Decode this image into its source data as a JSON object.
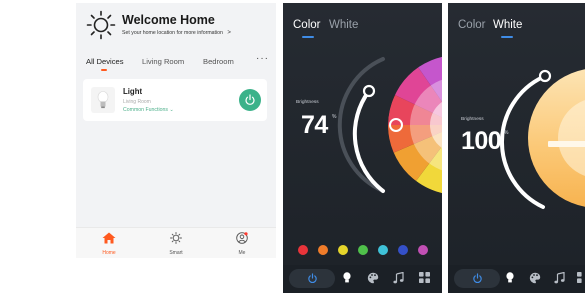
{
  "home": {
    "title": "Welcome Home",
    "subtitle": "Set your home location for more information",
    "subtitle_chevron": ">",
    "tabs": [
      {
        "label": "All Devices",
        "active": true
      },
      {
        "label": "Living Room",
        "active": false
      },
      {
        "label": "Bedroom",
        "active": false
      }
    ],
    "more_label": "···",
    "device": {
      "name": "Light",
      "room": "Living Room",
      "functions_label": "Common Functions",
      "functions_chevron": "⌄"
    },
    "bottom_nav": [
      {
        "label": "Home",
        "icon": "home-icon",
        "active": true
      },
      {
        "label": "Smart",
        "icon": "sun-icon",
        "active": false
      },
      {
        "label": "Me",
        "icon": "person-icon",
        "active": false
      }
    ],
    "colors": {
      "accent": "#ff5a1f",
      "power": "#3bb28a"
    }
  },
  "color_panel": {
    "tabs": [
      {
        "label": "Color",
        "active": true
      },
      {
        "label": "White",
        "active": false
      }
    ],
    "brightness_label": "Brightness",
    "brightness_value": "74",
    "brightness_unit": "%",
    "swatches": [
      "#e8343a",
      "#f07c2a",
      "#e6d52b",
      "#4fc04a",
      "#3fc2d8",
      "#3450c8",
      "#c14fb4"
    ]
  },
  "white_panel": {
    "tabs": [
      {
        "label": "Color",
        "active": false
      },
      {
        "label": "White",
        "active": true
      }
    ],
    "brightness_label": "Brightness",
    "brightness_value": "100",
    "brightness_unit": "%"
  },
  "dock_icons": [
    "power-icon",
    "bulb-icon",
    "palette-icon",
    "music-icon",
    "grid-icon"
  ]
}
